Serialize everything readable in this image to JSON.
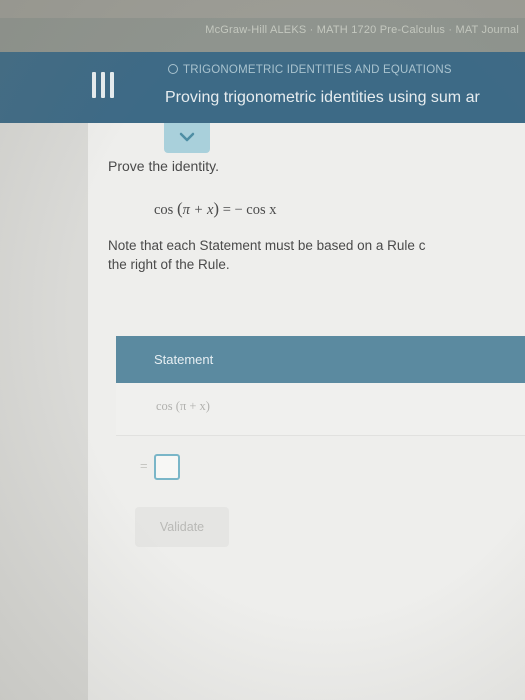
{
  "browser": {
    "bookmarks_text": "McGraw-Hill ALEKS · MATH 1720 Pre-Calculus · MAT Journal"
  },
  "header": {
    "topic": "TRIGONOMETRIC IDENTITIES AND EQUATIONS",
    "title": "Proving trigonometric identities using sum ar"
  },
  "problem": {
    "instruction": "Prove the identity.",
    "identity": {
      "lhs_func": "cos",
      "lhs_arg": "π + x",
      "equals": "=",
      "rhs": "− cos x"
    },
    "note_line1": "Note that each Statement must be based on a Rule c",
    "note_line2": "the right of the Rule."
  },
  "table": {
    "header": "Statement",
    "row1": "cos (π + x)",
    "eq_sign": "="
  },
  "buttons": {
    "validate": "Validate"
  },
  "colors": {
    "header_bg": "#3d6a86",
    "table_header_bg": "#5b8aa0",
    "tab_accent": "#a9d0db",
    "input_border": "#7ab6c8"
  }
}
